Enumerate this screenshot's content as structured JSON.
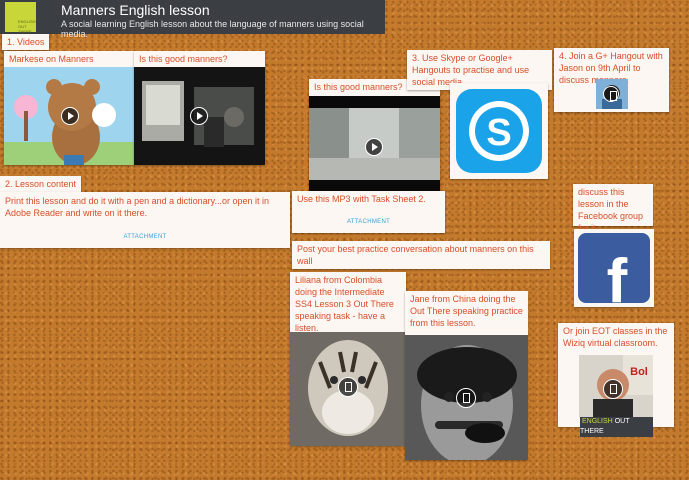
{
  "header": {
    "title": "Manners English lesson",
    "subtitle": "A social learning English lesson about the language of manners using social media.",
    "logo_text": "ENGLISH OUT THERE"
  },
  "notes": {
    "videos": "1. Videos",
    "markese": "Markese on Manners",
    "good1": "Is this good manners?",
    "lesson": "2. Lesson content",
    "lesson_body": "Print this lesson and do it with a pen and a dictionary...or open it in Adobe Reader and write on it there.",
    "attachment": "ATTACHMENT",
    "good2": "Is this good manners?",
    "mp3": "Use this MP3 with Task Sheet 2.",
    "attachment2": "ATTACHMENT",
    "post": "Post your best practice conversation about manners on this wall",
    "skype": "3. Use Skype or Google+ Hangouts to practise and use social media",
    "gplus": "4. Join a G+ Hangout with Jason on 9th April to discuss manners.",
    "facebook": "discuss this lesson in the Facebook group for it.",
    "liliana": "Liliana from Colombia doing the Intermediate SS4 Lesson 3 Out There speaking task - have a listen.",
    "jane": "Jane from China doing the Out There speaking practice from this lesson.",
    "wiziq": "Or join EOT classes in the Wiziq virtual classroom.",
    "eot_label_a": "ENGLISH",
    "eot_label_b": "OUT THERE"
  },
  "colors": {
    "caption": "#d84e2a",
    "attachment": "#3aa0d8",
    "header_bg": "#3b3f44",
    "logo": "#c8d63a"
  }
}
